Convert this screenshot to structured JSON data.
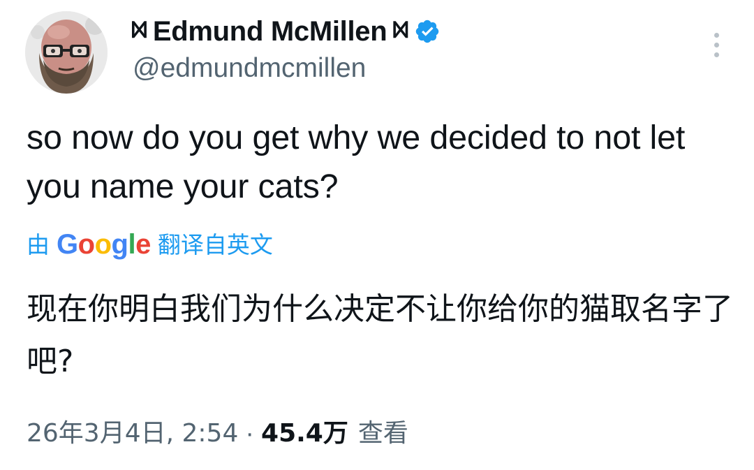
{
  "tweet": {
    "author": {
      "display_name": "Edmund McMillen",
      "name_decoration_glyph": "ᢂ",
      "handle": "@edmundmcmillen",
      "verified": true,
      "avatar_icon": "bearded-man-with-glasses-avatar"
    },
    "text": "so now do you get why we decided to not let you name your cats?",
    "translation": {
      "prefix": "由",
      "provider": "Google",
      "suffix": "翻译自英文",
      "text": "现在你明白我们为什么决定不让你给你的猫取名字了吧?"
    },
    "meta": {
      "timestamp": "26年3月4日, 2:54",
      "separator": "·",
      "views": "45.4万",
      "views_label": "查看"
    },
    "icons": {
      "verified": "verified-badge-icon",
      "more": "more-options-icon"
    }
  },
  "colors": {
    "text_primary": "#0f1419",
    "text_secondary": "#536471",
    "accent": "#1d9bf0",
    "google_blue": "#4285f4",
    "google_red": "#ea4335",
    "google_yellow": "#fbbc05",
    "google_green": "#34a853"
  }
}
